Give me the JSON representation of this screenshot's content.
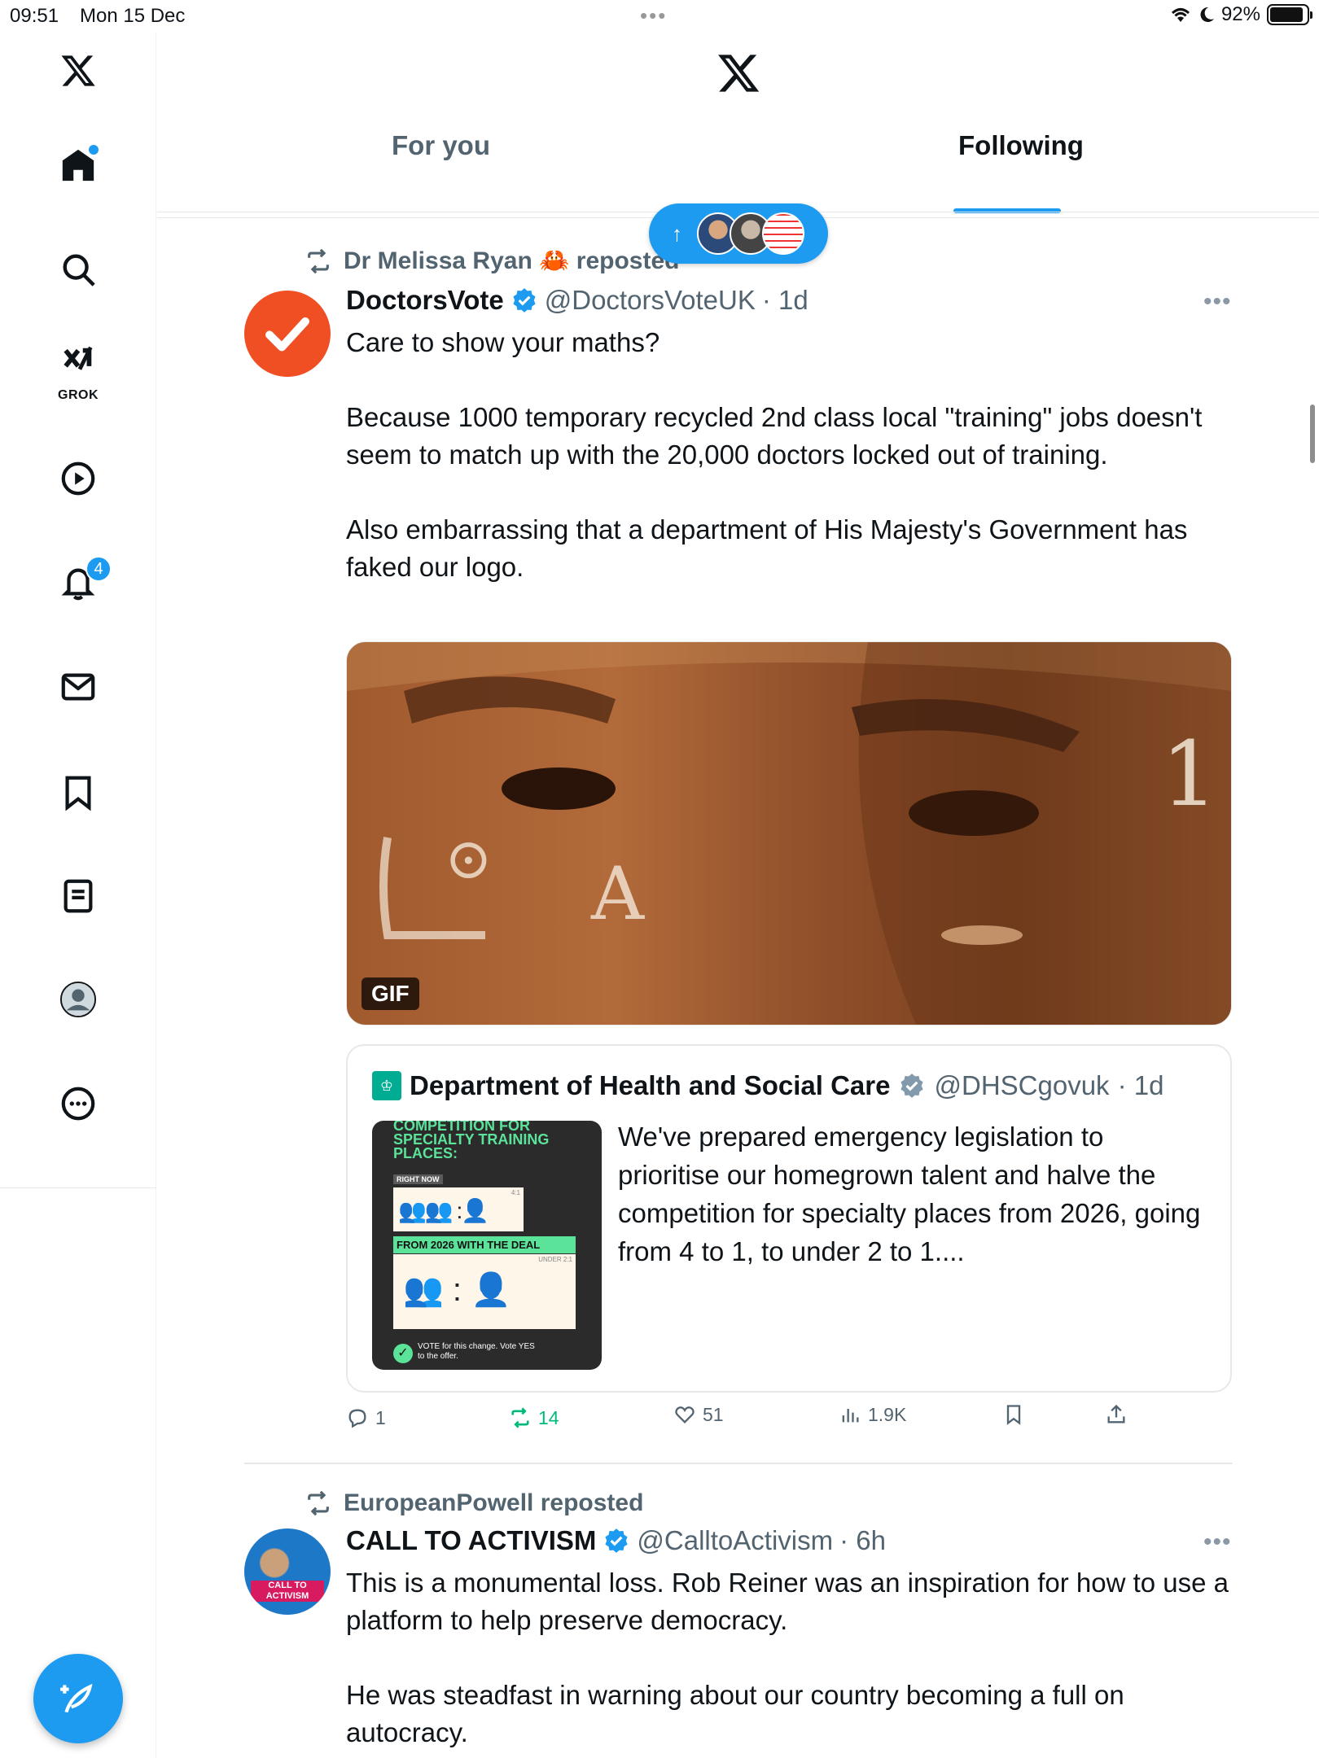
{
  "status_bar": {
    "time": "09:51",
    "date": "Mon 15 Dec",
    "battery": "92%",
    "battery_level": 0.92
  },
  "sidebar": {
    "items": [
      {
        "name": "home-icon"
      },
      {
        "name": "search-icon"
      },
      {
        "name": "grok-icon",
        "label": "GROK"
      },
      {
        "name": "video-icon"
      },
      {
        "name": "notifications-icon",
        "badge": "4"
      },
      {
        "name": "messages-icon"
      },
      {
        "name": "bookmarks-icon"
      },
      {
        "name": "lists-icon"
      },
      {
        "name": "profile-icon"
      },
      {
        "name": "more-icon"
      }
    ]
  },
  "header": {
    "tabs": [
      {
        "label": "For you",
        "active": false
      },
      {
        "label": "Following",
        "active": true
      }
    ]
  },
  "new_posts_pill": {
    "arrow": "↑"
  },
  "posts": [
    {
      "repost_by": "Dr Melissa Ryan 🦀 reposted",
      "author": "DoctorsVote",
      "handle": "@DoctorsVoteUK",
      "time": "· 1d",
      "text": "Care to show your maths?\n\nBecause 1000 temporary recycled 2nd class local \"training\" jobs doesn't seem to match up with the 20,000 doctors locked out of training.\n\nAlso embarrassing that a department of His Majesty's Government has faked our logo.",
      "media_badge": "GIF",
      "quote": {
        "author": "Department of Health and Social Care",
        "handle": "@DHSCgovuk",
        "time": "· 1d",
        "text": "We've prepared emergency legislation to prioritise our homegrown talent and halve the competition for specialty places from 2026, going from 4 to 1, to under 2 to 1....",
        "image_text": {
          "title": "COMPETITION FOR SPECIALTY TRAINING PLACES:",
          "right_now": "RIGHT NOW",
          "ratio_now": "4:1",
          "from_2026": "FROM 2026 WITH THE DEAL",
          "ratio_new": "UNDER 2:1",
          "vote": "VOTE for this change. Vote YES to the offer."
        }
      },
      "actions": {
        "replies": "1",
        "reposts": "14",
        "likes": "51",
        "views": "1.9K"
      }
    },
    {
      "repost_by": "EuropeanPowell reposted",
      "author": "CALL TO ACTIVISM",
      "handle": "@CalltoActivism",
      "time": "· 6h",
      "text": "This is a monumental loss. Rob Reiner was an inspiration for how to use a platform to help preserve democracy.\n\nHe was steadfast in warning about our country becoming a full on autocracy.",
      "avatar_text": "CALL TO ACTIVISM"
    }
  ],
  "colors": {
    "accent": "#1d9bf0",
    "text": "#0f1419",
    "secondary": "#536471",
    "repost_green": "#00ba7c",
    "doctorsvote_orange": "#f04e23"
  }
}
